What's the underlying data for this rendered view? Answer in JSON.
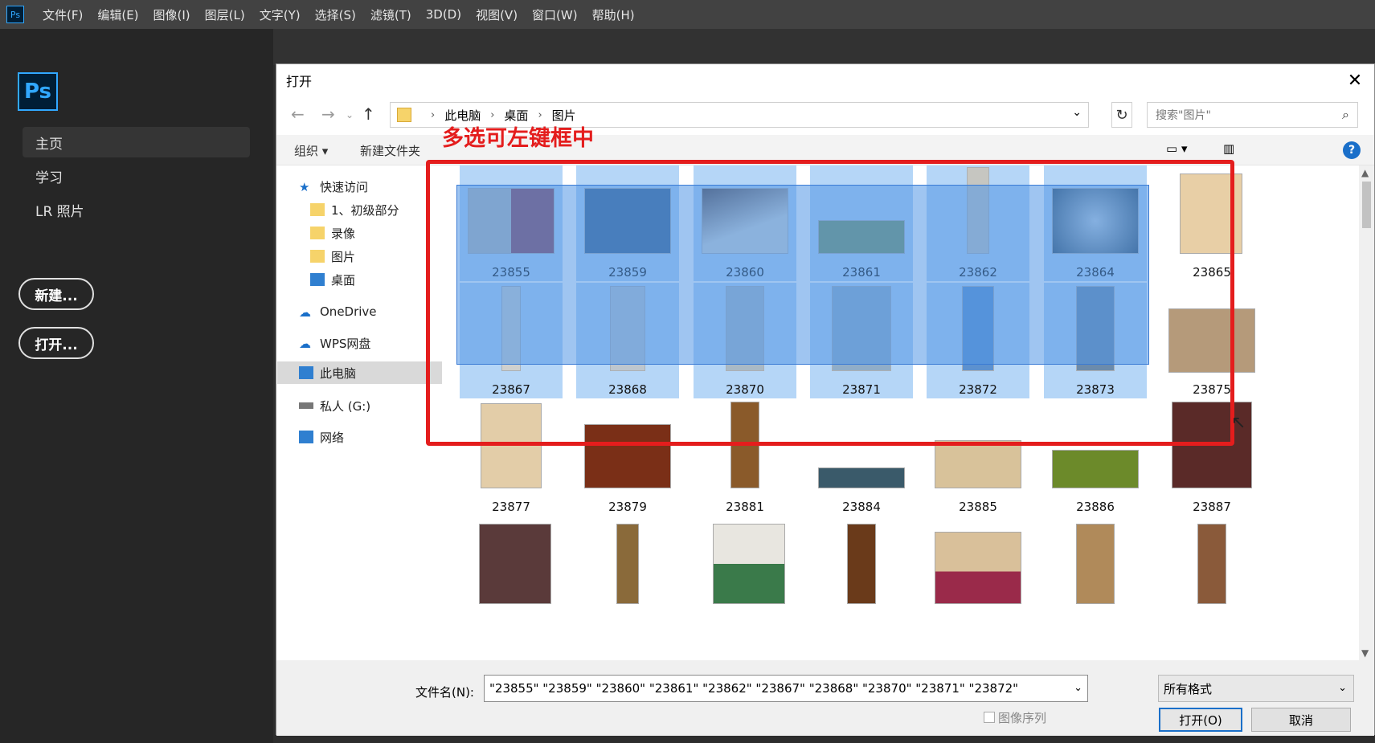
{
  "menubar": {
    "app_icon": "Ps",
    "items": [
      "文件(F)",
      "编辑(E)",
      "图像(I)",
      "图层(L)",
      "文字(Y)",
      "选择(S)",
      "滤镜(T)",
      "3D(D)",
      "视图(V)",
      "窗口(W)",
      "帮助(H)"
    ]
  },
  "home": {
    "logo": "Ps",
    "nav": [
      "主页",
      "学习",
      "LR 照片"
    ],
    "new_button": "新建...",
    "open_button": "打开..."
  },
  "dialog": {
    "title": "打开",
    "close": "✕",
    "breadcrumb": [
      "此电脑",
      "桌面",
      "图片"
    ],
    "search_placeholder": "搜索\"图片\"",
    "toolbar": {
      "organize": "组织 ▾",
      "new_folder": "新建文件夹"
    },
    "sidebar": [
      "快速访问",
      "1、初级部分",
      "录像",
      "图片",
      "桌面",
      "OneDrive",
      "WPS网盘",
      "此电脑",
      "私人 (G:)",
      "网络"
    ],
    "files_row1": [
      "23855",
      "23859",
      "23860",
      "23861",
      "23862",
      "23864",
      "23865"
    ],
    "files_row2": [
      "23867",
      "23868",
      "23870",
      "23871",
      "23872",
      "23873",
      "23875"
    ],
    "files_row3": [
      "23877",
      "23879",
      "23881",
      "23884",
      "23885",
      "23886",
      "23887"
    ],
    "filename_label": "文件名(N):",
    "filename_value": "\"23855\" \"23859\" \"23860\" \"23861\" \"23862\" \"23867\" \"23868\" \"23870\" \"23871\" \"23872\"",
    "filetype": "所有格式",
    "image_sequence": "图像序列",
    "open": "打开(O)",
    "cancel": "取消"
  },
  "annotation": "多选可左键框中",
  "colors": {
    "selection": "#5096e6",
    "annotation_red": "#e41d1d",
    "ps_blue": "#31a8ff"
  }
}
